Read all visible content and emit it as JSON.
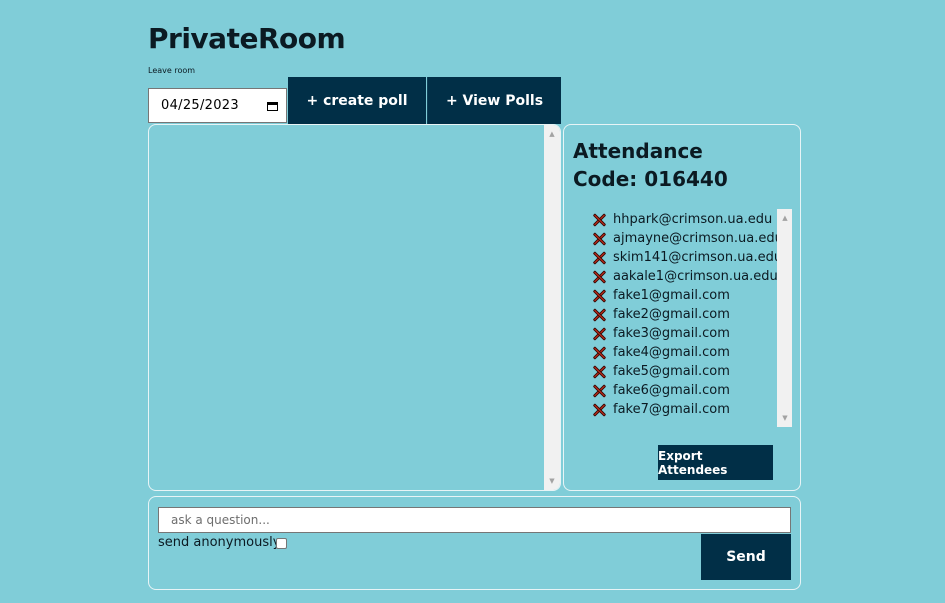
{
  "app": {
    "title": "PrivateRoom",
    "leave_link": "Leave room"
  },
  "toolbar": {
    "date_value": "04/25/2023",
    "create_poll_label": "+ create poll",
    "view_polls_label": "+ View Polls"
  },
  "attendance": {
    "title_line1": "Attendance",
    "title_line2": "Code: 016440",
    "attendees": [
      "hhpark@crimson.ua.edu",
      "ajmayne@crimson.ua.edu",
      "skim141@crimson.ua.edu",
      "aakale1@crimson.ua.edu",
      "fake1@gmail.com",
      "fake2@gmail.com",
      "fake3@gmail.com",
      "fake4@gmail.com",
      "fake5@gmail.com",
      "fake6@gmail.com",
      "fake7@gmail.com"
    ],
    "status_icon": "x-mark-icon",
    "export_label": "Export Attendees"
  },
  "question": {
    "placeholder": "ask a question...",
    "anonymous_label": "send anonymously",
    "anonymous_checked": false,
    "send_label": "Send"
  },
  "colors": {
    "background": "#80cdd8",
    "accent": "#012f47",
    "absent_mark": "#d8321f"
  }
}
